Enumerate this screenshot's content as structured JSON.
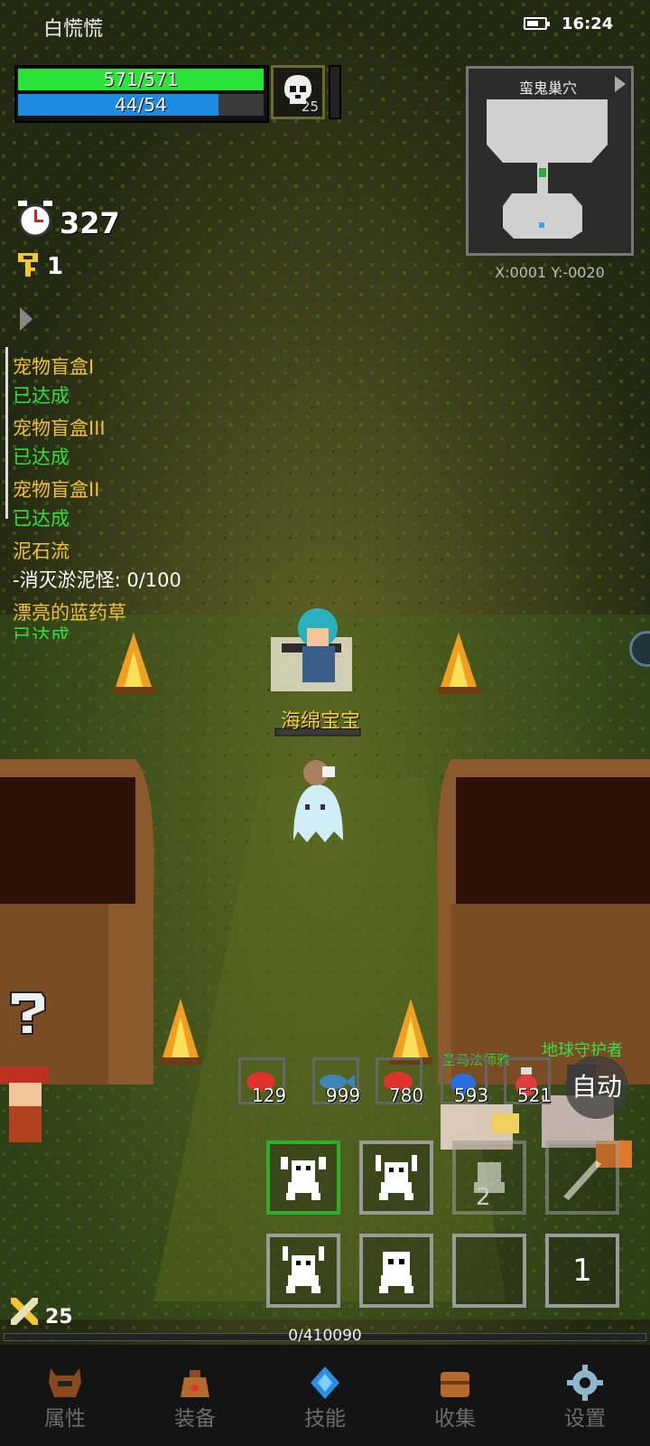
{
  "status_bar": {
    "app_name": "白慌慌",
    "time": "16:24"
  },
  "hp": {
    "text": "571/571",
    "fraction": 1.0
  },
  "mp": {
    "text": "44/54",
    "fraction": 0.815
  },
  "boss": {
    "level": "25",
    "icon": "skull-icon"
  },
  "minimap": {
    "title": "蛮鬼巢穴",
    "coords": "X:0001  Y:-0020"
  },
  "timer": {
    "value": "327",
    "icon": "alarm-clock-icon"
  },
  "keys": {
    "value": "1",
    "icon": "key-icon"
  },
  "quests": [
    {
      "title": "宠物盲盒I",
      "status": "已达成"
    },
    {
      "title": "宠物盲盒III",
      "status": "已达成"
    },
    {
      "title": "宠物盲盒II",
      "status": "已达成"
    },
    {
      "title": "泥石流",
      "status": "-消灭淤泥怪: 0/100"
    },
    {
      "title": "漂亮的蓝药草",
      "status": "已达成"
    }
  ],
  "characters": {
    "player_name": "海绵宝宝",
    "ally_name": "地球守护者",
    "pet_name": "圣马法师雅"
  },
  "items": [
    {
      "icon": "red-meat-icon",
      "count": "129",
      "color": "#e0322a"
    },
    {
      "icon": "fish-icon",
      "count": "999",
      "color": "#3a86b8"
    },
    {
      "icon": "red-meat-icon",
      "count": "780",
      "color": "#e0322a"
    },
    {
      "icon": "blue-potion-icon",
      "count": "593",
      "color": "#2a6ee0"
    },
    {
      "icon": "red-potion-icon",
      "count": "521",
      "color": "#e03a3a"
    }
  ],
  "auto_button": "自动",
  "skills": {
    "slot_6": "2",
    "slot_8": "1"
  },
  "level": {
    "value": "25"
  },
  "exp": {
    "text": "0/410090",
    "fraction": 0.0
  },
  "nav": [
    {
      "label": "属性",
      "icon": "helmet-icon"
    },
    {
      "label": "装备",
      "icon": "bag-icon"
    },
    {
      "label": "技能",
      "icon": "crystal-icon"
    },
    {
      "label": "收集",
      "icon": "chest-icon"
    },
    {
      "label": "设置",
      "icon": "gear-icon"
    }
  ]
}
